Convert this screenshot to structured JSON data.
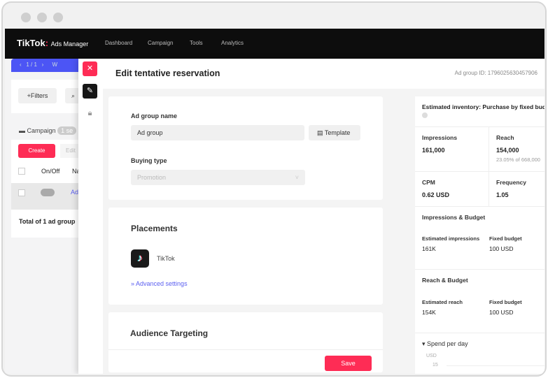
{
  "nav": {
    "logo": "TikTok",
    "logo_sub": "Ads Manager",
    "items": [
      "Dashboard",
      "Campaign",
      "Tools",
      "Analytics"
    ]
  },
  "pager": {
    "text": "‹   1 / 1   ›",
    "extra": "W"
  },
  "background": {
    "filters": "+Filters",
    "campaign": "Campaign",
    "badge": "1 se",
    "create": "Create",
    "edit": "Edit",
    "col_onoff": "On/Off",
    "col_name": "Na",
    "row_name": "Ad",
    "total": "Total of 1 ad group"
  },
  "drawer": {
    "title": "Edit tentative reservation",
    "ad_group_id": "Ad group ID: 1796025630457906",
    "ad_group_name_label": "Ad group name",
    "ad_group_name_value": "Ad group",
    "template": "Template",
    "buying_type_label": "Buying type",
    "buying_type_value": "Promotion",
    "placements": "Placements",
    "placement_item": "TikTok",
    "advanced": "Advanced settings",
    "audience": "Audience Targeting",
    "save": "Save"
  },
  "inventory": {
    "title": "Estimated inventory: Purchase by fixed budget",
    "impressions_label": "Impressions",
    "impressions": "161,000",
    "reach_label": "Reach",
    "reach": "154,000",
    "reach_sub": "23.05% of 668,000",
    "cpm_label": "CPM",
    "cpm": "0.62 USD",
    "frequency_label": "Frequency",
    "frequency": "1.05",
    "ib_title": "Impressions & Budget",
    "est_impr_label": "Estimated impressions",
    "est_impr": "161K",
    "fixed_label": "Fixed budget",
    "fixed": "100 USD",
    "rb_title": "Reach & Budget",
    "est_reach_label": "Estimated reach",
    "est_reach": "154K",
    "fixed2_label": "Fixed budget",
    "fixed2": "100 USD",
    "spend": "Spend per day",
    "unit": "USD",
    "tick": "15"
  },
  "colors": {
    "brand": "#fe2c55",
    "accent": "#5b5ff0"
  }
}
